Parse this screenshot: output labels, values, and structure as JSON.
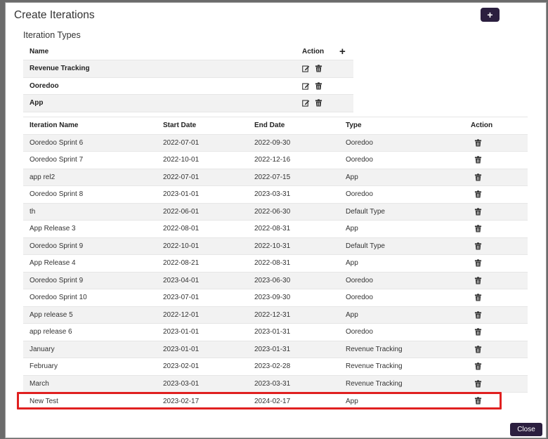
{
  "modal": {
    "title": "Create Iterations",
    "add_button_label": "+",
    "close_label": "Close"
  },
  "iteration_types": {
    "title": "Iteration Types",
    "headers": {
      "name": "Name",
      "action": "Action",
      "add": "+"
    },
    "rows": [
      {
        "name": "Revenue Tracking"
      },
      {
        "name": "Ooredoo"
      },
      {
        "name": "App"
      }
    ]
  },
  "iterations": {
    "headers": {
      "name": "Iteration Name",
      "start": "Start Date",
      "end": "End Date",
      "type": "Type",
      "action": "Action"
    },
    "rows": [
      {
        "name": "Ooredoo Sprint 6",
        "start": "2022-07-01",
        "end": "2022-09-30",
        "type": "Ooredoo"
      },
      {
        "name": "Ooredoo Sprint 7",
        "start": "2022-10-01",
        "end": "2022-12-16",
        "type": "Ooredoo"
      },
      {
        "name": "app rel2",
        "start": "2022-07-01",
        "end": "2022-07-15",
        "type": "App"
      },
      {
        "name": "Ooredoo Sprint 8",
        "start": "2023-01-01",
        "end": "2023-03-31",
        "type": "Ooredoo"
      },
      {
        "name": "th",
        "start": "2022-06-01",
        "end": "2022-06-30",
        "type": "Default Type"
      },
      {
        "name": "App Release 3",
        "start": "2022-08-01",
        "end": "2022-08-31",
        "type": "App"
      },
      {
        "name": "Ooredoo Sprint 9",
        "start": "2022-10-01",
        "end": "2022-10-31",
        "type": "Default Type"
      },
      {
        "name": "App Release 4",
        "start": "2022-08-21",
        "end": "2022-08-31",
        "type": "App"
      },
      {
        "name": "Ooredoo Sprint 9",
        "start": "2023-04-01",
        "end": "2023-06-30",
        "type": "Ooredoo"
      },
      {
        "name": "Ooredoo Sprint 10",
        "start": "2023-07-01",
        "end": "2023-09-30",
        "type": "Ooredoo"
      },
      {
        "name": "App release 5",
        "start": "2022-12-01",
        "end": "2022-12-31",
        "type": "App"
      },
      {
        "name": "app release 6",
        "start": "2023-01-01",
        "end": "2023-01-31",
        "type": "Ooredoo"
      },
      {
        "name": "January",
        "start": "2023-01-01",
        "end": "2023-01-31",
        "type": "Revenue Tracking"
      },
      {
        "name": "February",
        "start": "2023-02-01",
        "end": "2023-02-28",
        "type": "Revenue Tracking"
      },
      {
        "name": "March",
        "start": "2023-03-01",
        "end": "2023-03-31",
        "type": "Revenue Tracking"
      },
      {
        "name": "New Test",
        "start": "2023-02-17",
        "end": "2024-02-17",
        "type": "App"
      }
    ]
  },
  "colors": {
    "button_bg": "#2b1f3f",
    "highlight": "#e02020",
    "stripe": "#f2f2f2"
  }
}
